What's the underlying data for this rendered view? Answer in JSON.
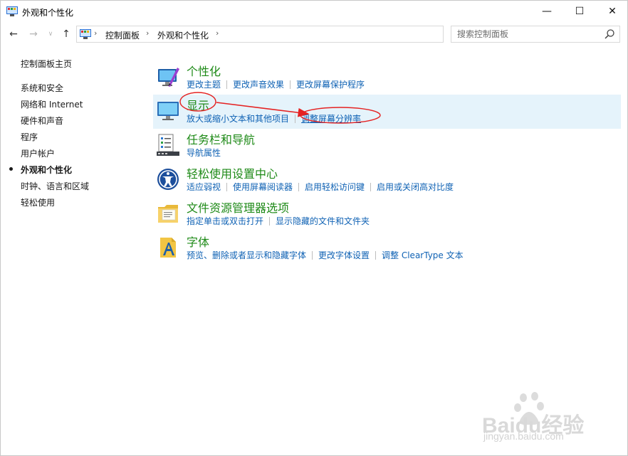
{
  "window": {
    "title": "外观和个性化",
    "controls": {
      "minimize": "—",
      "maximize": "☐",
      "close": "✕"
    }
  },
  "address": {
    "crumbs": [
      "控制面板",
      "外观和个性化"
    ],
    "separator": "›",
    "search_placeholder": "搜索控制面板"
  },
  "sidebar": {
    "home": "控制面板主页",
    "items": [
      {
        "label": "系统和安全",
        "active": false
      },
      {
        "label": "网络和 Internet",
        "active": false
      },
      {
        "label": "硬件和声音",
        "active": false
      },
      {
        "label": "程序",
        "active": false
      },
      {
        "label": "用户帐户",
        "active": false
      },
      {
        "label": "外观和个性化",
        "active": true
      },
      {
        "label": "时钟、语言和区域",
        "active": false
      },
      {
        "label": "轻松使用",
        "active": false
      }
    ]
  },
  "categories": [
    {
      "title": "个性化",
      "icon": "personalization-icon",
      "links": [
        "更改主题",
        "更改声音效果",
        "更改屏幕保护程序"
      ]
    },
    {
      "title": "显示",
      "icon": "display-icon",
      "links": [
        "放大或缩小文本和其他项目",
        "调整屏幕分辨率"
      ],
      "highlighted": true
    },
    {
      "title": "任务栏和导航",
      "icon": "taskbar-icon",
      "links": [
        "导航属性"
      ]
    },
    {
      "title": "轻松使用设置中心",
      "icon": "ease-of-access-icon",
      "links": [
        "适应弱视",
        "使用屏幕阅读器",
        "启用轻松访问键",
        "启用或关闭高对比度"
      ]
    },
    {
      "title": "文件资源管理器选项",
      "icon": "folder-options-icon",
      "links": [
        "指定单击或双击打开",
        "显示隐藏的文件和文件夹"
      ]
    },
    {
      "title": "字体",
      "icon": "fonts-icon",
      "links": [
        "预览、删除或者显示和隐藏字体",
        "更改字体设置",
        "调整 ClearType 文本"
      ]
    }
  ],
  "watermark": {
    "brand": "Baidu经验",
    "url": "jingyan.baidu.com"
  },
  "colors": {
    "category_title": "#1e8a17",
    "link": "#0f62b4",
    "highlight": "#e5f3fb",
    "annotation": "#e52222"
  }
}
